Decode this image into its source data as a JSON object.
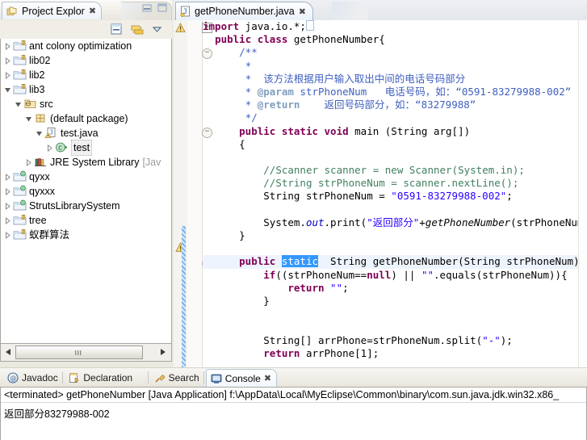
{
  "left_view": {
    "tab_label": "Project Explor",
    "tab_icon": "project-explorer-icon",
    "close_icon": "close-icon",
    "toolbar": [
      {
        "name": "collapse-all-icon",
        "label": "Collapse All"
      },
      {
        "name": "link-with-editor-icon",
        "label": "Link with Editor"
      },
      {
        "name": "view-menu-icon",
        "label": "View Menu"
      }
    ],
    "minimize_icon": "minimize-icon",
    "maximize_icon": "maximize-icon",
    "tree": [
      {
        "label": "ant colony optimization",
        "depth": 0,
        "state": "collapsed",
        "icon": "java-project-icon",
        "selected": false
      },
      {
        "label": "lib02",
        "depth": 0,
        "state": "collapsed",
        "icon": "java-project-icon",
        "selected": false
      },
      {
        "label": "lib2",
        "depth": 0,
        "state": "collapsed",
        "icon": "java-project-icon",
        "selected": false
      },
      {
        "label": "lib3",
        "depth": 0,
        "state": "expanded",
        "icon": "java-project-icon",
        "selected": false
      },
      {
        "label": "src",
        "depth": 1,
        "state": "expanded",
        "icon": "source-folder-icon",
        "selected": false
      },
      {
        "label": "(default package)",
        "depth": 2,
        "state": "expanded",
        "icon": "package-icon",
        "selected": false
      },
      {
        "label": "test.java",
        "depth": 3,
        "state": "expanded",
        "icon": "java-file-warning-icon",
        "selected": false
      },
      {
        "label": "test",
        "depth": 4,
        "state": "collapsed",
        "icon": "java-class-icon",
        "selected": true
      },
      {
        "label": "JRE System Library",
        "suffix": "[Jav",
        "depth": 2,
        "state": "collapsed",
        "icon": "jre-library-icon",
        "selected": false
      },
      {
        "label": "qyxx",
        "depth": 0,
        "state": "collapsed",
        "icon": "web-project-icon",
        "selected": false
      },
      {
        "label": "qyxxx",
        "depth": 0,
        "state": "collapsed",
        "icon": "web-project-icon",
        "selected": false
      },
      {
        "label": "StrutsLibrarySystem",
        "depth": 0,
        "state": "collapsed",
        "icon": "web-project-icon",
        "selected": false
      },
      {
        "label": "tree",
        "depth": 0,
        "state": "collapsed",
        "icon": "java-project-icon",
        "selected": false
      },
      {
        "label": "蚁群算法",
        "depth": 0,
        "state": "collapsed",
        "icon": "java-project-icon",
        "selected": false
      }
    ],
    "hscroll": {
      "left_arrow_icon": "scroll-left-icon",
      "right_arrow_icon": "scroll-right-icon",
      "grip_icon": "scroll-grip-icon"
    }
  },
  "editor": {
    "tab_label": "getPhoneNumber.java",
    "tab_icon": "java-file-icon",
    "close_icon": "close-icon",
    "warning_icon": "warning-marker-icon",
    "lines": [
      {
        "t": "import",
        "segs": [
          {
            "c": "kw",
            "s": "import"
          },
          {
            "c": "",
            "s": " java.io.*;"
          },
          {
            "c": "box",
            "s": " "
          }
        ],
        "fold": "plus"
      },
      {
        "t": "classdecl",
        "segs": [
          {
            "c": "",
            "s": "  "
          },
          {
            "c": "kw",
            "s": "public class"
          },
          {
            "c": "",
            "s": " getPhoneNumber{"
          }
        ]
      },
      {
        "t": "doc",
        "segs": [
          {
            "c": "",
            "s": "      "
          },
          {
            "c": "doc",
            "s": "/**"
          }
        ],
        "fold": "minus"
      },
      {
        "t": "doc",
        "segs": [
          {
            "c": "",
            "s": "       "
          },
          {
            "c": "doc",
            "s": "*"
          }
        ]
      },
      {
        "t": "doc",
        "segs": [
          {
            "c": "",
            "s": "       "
          },
          {
            "c": "doc",
            "s": "*  该方法根据用户输入取出中间的电话号码部分"
          }
        ]
      },
      {
        "t": "doc",
        "segs": [
          {
            "c": "",
            "s": "       "
          },
          {
            "c": "doc",
            "s": "* "
          },
          {
            "c": "doctag",
            "s": "@param"
          },
          {
            "c": "doc",
            "s": " strPhoneNum   电话号码，如：“0591-83279988-002”"
          }
        ]
      },
      {
        "t": "doc",
        "segs": [
          {
            "c": "",
            "s": "       "
          },
          {
            "c": "doc",
            "s": "* "
          },
          {
            "c": "doctag",
            "s": "@return"
          },
          {
            "c": "doc",
            "s": "    返回号码部分，如：“83279988”"
          }
        ]
      },
      {
        "t": "doc",
        "segs": [
          {
            "c": "",
            "s": "       "
          },
          {
            "c": "doc",
            "s": "*/"
          }
        ]
      },
      {
        "t": "method",
        "segs": [
          {
            "c": "",
            "s": "      "
          },
          {
            "c": "kw",
            "s": "public static void"
          },
          {
            "c": "",
            "s": " main (String arg[])"
          }
        ],
        "fold": "minus"
      },
      {
        "t": "brace",
        "segs": [
          {
            "c": "",
            "s": "      {"
          }
        ]
      },
      {
        "t": "blank",
        "segs": [
          {
            "c": "",
            "s": ""
          }
        ]
      },
      {
        "t": "comment",
        "segs": [
          {
            "c": "",
            "s": "          "
          },
          {
            "c": "cmt",
            "s": "//Scanner scanner = new Scanner(System.in);"
          }
        ]
      },
      {
        "t": "comment",
        "segs": [
          {
            "c": "",
            "s": "          "
          },
          {
            "c": "cmt",
            "s": "//String strPhoneNum = scanner.nextLine();"
          }
        ]
      },
      {
        "t": "code",
        "segs": [
          {
            "c": "",
            "s": "          String strPhoneNum = "
          },
          {
            "c": "str",
            "s": "\"0591-83279988-002\""
          },
          {
            "c": "",
            "s": ";"
          }
        ]
      },
      {
        "t": "blank",
        "segs": [
          {
            "c": "",
            "s": ""
          }
        ]
      },
      {
        "t": "code",
        "segs": [
          {
            "c": "",
            "s": "          System."
          },
          {
            "c": "fldi",
            "s": "out"
          },
          {
            "c": "",
            "s": ".print("
          },
          {
            "c": "str",
            "s": "\"返回部分\""
          },
          {
            "c": "",
            "s": "+"
          },
          {
            "c": "stat",
            "s": "getPhoneNumber"
          },
          {
            "c": "",
            "s": "(strPhoneNum));"
          }
        ]
      },
      {
        "t": "brace",
        "segs": [
          {
            "c": "",
            "s": "      }"
          }
        ]
      },
      {
        "t": "blank",
        "segs": [
          {
            "c": "",
            "s": ""
          }
        ]
      },
      {
        "t": "methodhl",
        "segs": [
          {
            "c": "",
            "s": "      "
          },
          {
            "c": "kw",
            "s": "public "
          },
          {
            "c": "hl",
            "s": "static"
          },
          {
            "c": "",
            "s": "  String getPhoneNumber(String strPhoneNum){"
          }
        ],
        "fold": "minus",
        "current": true
      },
      {
        "t": "code",
        "segs": [
          {
            "c": "",
            "s": "          "
          },
          {
            "c": "kw",
            "s": "if"
          },
          {
            "c": "",
            "s": "((strPhoneNum=="
          },
          {
            "c": "kw",
            "s": "null"
          },
          {
            "c": "",
            "s": ") || "
          },
          {
            "c": "str",
            "s": "\"\""
          },
          {
            "c": "",
            "s": ".equals(strPhoneNum)){"
          }
        ]
      },
      {
        "t": "code",
        "segs": [
          {
            "c": "",
            "s": "              "
          },
          {
            "c": "kw",
            "s": "return"
          },
          {
            "c": "",
            "s": " "
          },
          {
            "c": "str",
            "s": "\"\""
          },
          {
            "c": "",
            "s": ";"
          }
        ]
      },
      {
        "t": "brace",
        "segs": [
          {
            "c": "",
            "s": "          }"
          }
        ]
      },
      {
        "t": "blank",
        "segs": [
          {
            "c": "",
            "s": ""
          }
        ]
      },
      {
        "t": "blank",
        "segs": [
          {
            "c": "",
            "s": ""
          }
        ]
      },
      {
        "t": "code",
        "segs": [
          {
            "c": "",
            "s": "          String[] arrPhone=strPhoneNum.split("
          },
          {
            "c": "str",
            "s": "\"-\""
          },
          {
            "c": "",
            "s": ");"
          }
        ]
      },
      {
        "t": "code",
        "segs": [
          {
            "c": "",
            "s": "          "
          },
          {
            "c": "kw",
            "s": "return"
          },
          {
            "c": "",
            "s": " arrPhone[1];"
          }
        ]
      },
      {
        "t": "blank",
        "segs": [
          {
            "c": "",
            "s": ""
          }
        ]
      },
      {
        "t": "blank",
        "segs": [
          {
            "c": "",
            "s": ""
          }
        ]
      },
      {
        "t": "brace",
        "segs": [
          {
            "c": "",
            "s": "      }"
          }
        ]
      }
    ]
  },
  "bottom": {
    "tabs": [
      {
        "label": "Javadoc",
        "icon": "javadoc-icon",
        "active": false
      },
      {
        "label": "Declaration",
        "icon": "declaration-icon",
        "active": false
      },
      {
        "label": "Search",
        "icon": "search-icon",
        "active": false
      },
      {
        "label": "Console",
        "icon": "console-icon",
        "active": true
      }
    ],
    "close_icon": "close-icon",
    "console": {
      "header": "<terminated> getPhoneNumber [Java Application] f:\\AppData\\Local\\MyEclipse\\Common\\binary\\com.sun.java.jdk.win32.x86_",
      "output": "返回部分83279988-002"
    }
  },
  "colors": {
    "keyword": "#7f0055",
    "string": "#2a00ff",
    "comment": "#3f7f5f",
    "javadoc": "#3f5fbf",
    "javadoc_tag": "#7f9fbf",
    "selection": "#3399ff",
    "current_line": "#eef4fd",
    "chrome": "#ece9e1"
  }
}
